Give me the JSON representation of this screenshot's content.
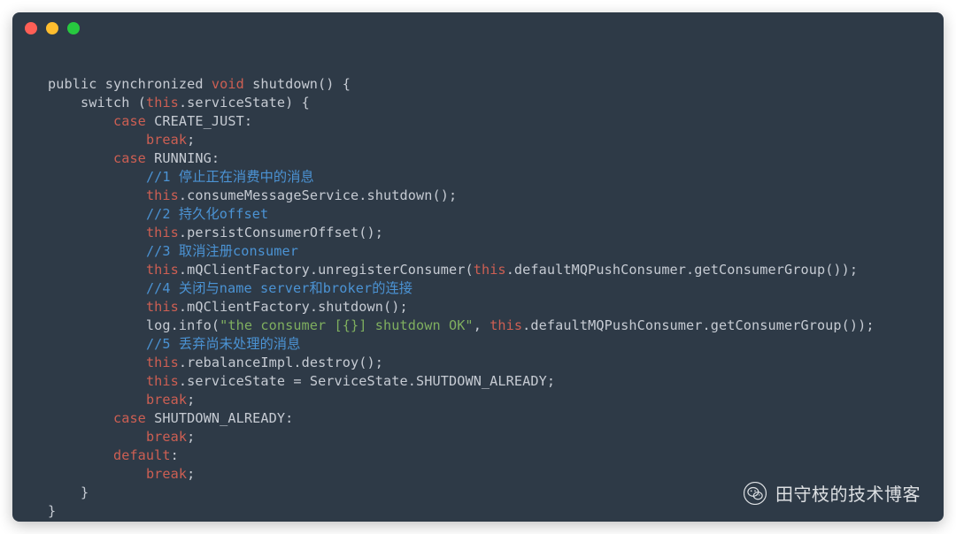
{
  "window": {
    "dots": [
      "red",
      "yellow",
      "green"
    ]
  },
  "code": {
    "tokens": [
      [
        [
          "public synchronized ",
          "d"
        ],
        [
          "void",
          "kw"
        ],
        [
          " shutdown() {",
          "d"
        ]
      ],
      [
        [
          "    ",
          "d"
        ],
        [
          "switch",
          "d"
        ],
        [
          " (",
          "d"
        ],
        [
          "this",
          "kw"
        ],
        [
          ".serviceState) {",
          "d"
        ]
      ],
      [
        [
          "        ",
          "d"
        ],
        [
          "case",
          "kw"
        ],
        [
          " CREATE_JUST:",
          "d"
        ]
      ],
      [
        [
          "            ",
          "d"
        ],
        [
          "break",
          "kw"
        ],
        [
          ";",
          "d"
        ]
      ],
      [
        [
          "        ",
          "d"
        ],
        [
          "case",
          "kw"
        ],
        [
          " RUNNING:",
          "d"
        ]
      ],
      [
        [
          "            ",
          "d"
        ],
        [
          "//1 停止正在消费中的消息",
          "c"
        ]
      ],
      [
        [
          "            ",
          "d"
        ],
        [
          "this",
          "kw"
        ],
        [
          ".consumeMessageService.shutdown();",
          "d"
        ]
      ],
      [
        [
          "            ",
          "d"
        ],
        [
          "//2 持久化offset",
          "c"
        ]
      ],
      [
        [
          "            ",
          "d"
        ],
        [
          "this",
          "kw"
        ],
        [
          ".persistConsumerOffset();",
          "d"
        ]
      ],
      [
        [
          "            ",
          "d"
        ],
        [
          "//3 取消注册consumer",
          "c"
        ]
      ],
      [
        [
          "            ",
          "d"
        ],
        [
          "this",
          "kw"
        ],
        [
          ".mQClientFactory.unregisterConsumer(",
          "d"
        ],
        [
          "this",
          "kw"
        ],
        [
          ".defaultMQPushConsumer.getConsumerGroup());",
          "d"
        ]
      ],
      [
        [
          "            ",
          "d"
        ],
        [
          "//4 关闭与name server和broker的连接",
          "c"
        ]
      ],
      [
        [
          "            ",
          "d"
        ],
        [
          "this",
          "kw"
        ],
        [
          ".mQClientFactory.shutdown();",
          "d"
        ]
      ],
      [
        [
          "            log.info(",
          "d"
        ],
        [
          "\"the consumer [{}] shutdown OK\"",
          "s"
        ],
        [
          ", ",
          "d"
        ],
        [
          "this",
          "kw"
        ],
        [
          ".defaultMQPushConsumer.getConsumerGroup());",
          "d"
        ]
      ],
      [
        [
          "            ",
          "d"
        ],
        [
          "//5 丢弃尚未处理的消息",
          "c"
        ]
      ],
      [
        [
          "            ",
          "d"
        ],
        [
          "this",
          "kw"
        ],
        [
          ".rebalanceImpl.destroy();",
          "d"
        ]
      ],
      [
        [
          "            ",
          "d"
        ],
        [
          "this",
          "kw"
        ],
        [
          ".serviceState = ServiceState.SHUTDOWN_ALREADY;",
          "d"
        ]
      ],
      [
        [
          "            ",
          "d"
        ],
        [
          "break",
          "kw"
        ],
        [
          ";",
          "d"
        ]
      ],
      [
        [
          "        ",
          "d"
        ],
        [
          "case",
          "kw"
        ],
        [
          " SHUTDOWN_ALREADY:",
          "d"
        ]
      ],
      [
        [
          "            ",
          "d"
        ],
        [
          "break",
          "kw"
        ],
        [
          ";",
          "d"
        ]
      ],
      [
        [
          "        ",
          "d"
        ],
        [
          "default",
          "kw"
        ],
        [
          ":",
          "d"
        ]
      ],
      [
        [
          "            ",
          "d"
        ],
        [
          "break",
          "kw"
        ],
        [
          ";",
          "d"
        ]
      ],
      [
        [
          "    }",
          "d"
        ]
      ],
      [
        [
          "}",
          "d"
        ]
      ]
    ]
  },
  "watermark": {
    "text": "田守枝的技术博客",
    "icon": "wechat-icon"
  }
}
